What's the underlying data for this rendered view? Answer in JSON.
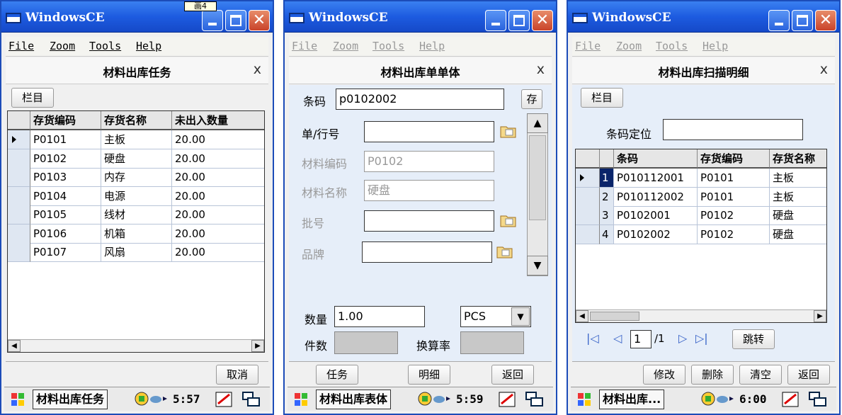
{
  "w1": {
    "title": "WindowsCE",
    "tooltip": "画4",
    "menu": [
      "File",
      "Zoom",
      "Tools",
      "Help"
    ],
    "form_title": "材料出库任务",
    "close": "x",
    "column_button": "栏目",
    "columns": [
      "存货编码",
      "存货名称",
      "未出入数量"
    ],
    "rows": [
      [
        "P0101",
        "主板",
        "20.00"
      ],
      [
        "P0102",
        "硬盘",
        "20.00"
      ],
      [
        "P0103",
        "内存",
        "20.00"
      ],
      [
        "P0104",
        "电源",
        "20.00"
      ],
      [
        "P0105",
        "线材",
        "20.00"
      ],
      [
        "P0106",
        "机箱",
        "20.00"
      ],
      [
        "P0107",
        "风扇",
        "20.00"
      ]
    ],
    "cancel": "取消",
    "task_app": "材料出库任务",
    "clock": "5:57"
  },
  "w2": {
    "title": "WindowsCE",
    "menu": [
      "File",
      "Zoom",
      "Tools",
      "Help"
    ],
    "form_title": "材料出库单单体",
    "close": "x",
    "barcode_label": "条码",
    "barcode_value": "p0102002",
    "save_label": "存",
    "doc_label": "单/行号",
    "doc_value": "",
    "mat_code_label": "材料编码",
    "mat_code_value": "P0102",
    "mat_name_label": "材料名称",
    "mat_name_value": "硬盘",
    "batch_label": "批号",
    "batch_value": "",
    "brand_label": "品牌",
    "brand_value": "",
    "qty_label": "数量",
    "qty_value": "1.00",
    "unit_value": "PCS",
    "pieces_label": "件数",
    "pieces_value": "",
    "rate_label": "换算率",
    "rate_value": "",
    "btn_task": "任务",
    "btn_detail": "明细",
    "btn_back": "返回",
    "task_app": "材料出库表体",
    "clock": "5:59"
  },
  "w3": {
    "title": "WindowsCE",
    "menu": [
      "File",
      "Zoom",
      "Tools",
      "Help"
    ],
    "form_title": "材料出库扫描明细",
    "close": "x",
    "column_button": "栏目",
    "locate_label": "条码定位",
    "locate_value": "",
    "columns": [
      "条码",
      "存货编码",
      "存货名称"
    ],
    "rows": [
      [
        "1",
        "P010112001",
        "P0101",
        "主板"
      ],
      [
        "2",
        "P010112002",
        "P0101",
        "主板"
      ],
      [
        "3",
        "P0102001",
        "P0102",
        "硬盘"
      ],
      [
        "4",
        "P0102002",
        "P0102",
        "硬盘"
      ]
    ],
    "page_value": "1",
    "page_total": "/1",
    "jump": "跳转",
    "btn_edit": "修改",
    "btn_delete": "删除",
    "btn_clear": "清空",
    "btn_back": "返回",
    "task_app": "材料出库...",
    "clock": "6:00"
  },
  "colors": {
    "titlebar": "#1d5be0",
    "close": "#c9432a",
    "grid_row_header": "#dfe7f2",
    "form_bg": "#e6eef9"
  }
}
